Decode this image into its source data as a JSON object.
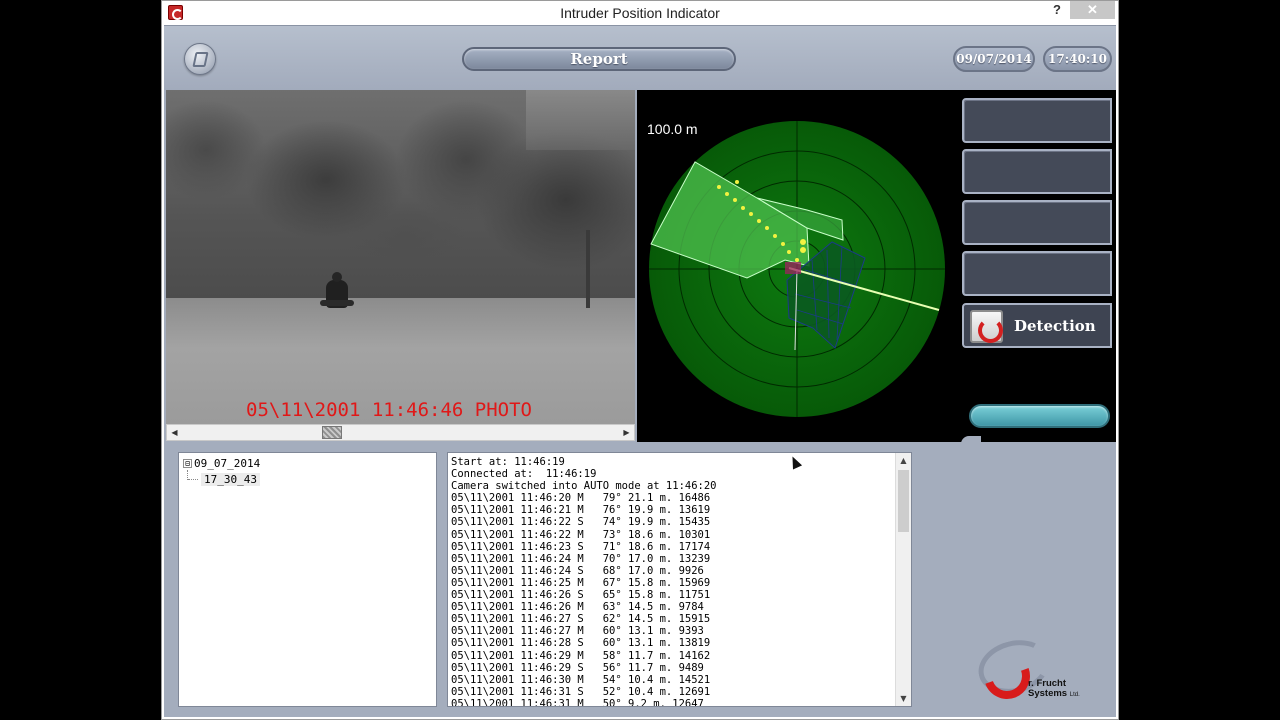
{
  "window": {
    "title": "Intruder Position Indicator",
    "help_label": "?",
    "close_label": "✕"
  },
  "header": {
    "report_label": "Report",
    "date": "09/07/2014",
    "time": "17:40:10"
  },
  "camera": {
    "overlay": "05\\11\\2001 11:46:46 PHOTO"
  },
  "radar": {
    "scale_label": "100.0 m"
  },
  "side_panel": {
    "detection_label": "Detection"
  },
  "tree": {
    "root_label": "09_07_2014",
    "child_label": "17_30_43",
    "expander": "⊟"
  },
  "log": {
    "lines": [
      "Start at: 11:46:19",
      "Connected at:  11:46:19",
      "Camera switched into AUTO mode at 11:46:20",
      "05\\11\\2001 11:46:20 M   79° 21.1 m. 16486",
      "05\\11\\2001 11:46:21 M   76° 19.9 m. 13619",
      "05\\11\\2001 11:46:22 S   74° 19.9 m. 15435",
      "05\\11\\2001 11:46:22 M   73° 18.6 m. 10301",
      "05\\11\\2001 11:46:23 S   71° 18.6 m. 17174",
      "05\\11\\2001 11:46:24 M   70° 17.0 m. 13239",
      "05\\11\\2001 11:46:24 S   68° 17.0 m. 9926",
      "05\\11\\2001 11:46:25 M   67° 15.8 m. 15969",
      "05\\11\\2001 11:46:26 S   65° 15.8 m. 11751",
      "05\\11\\2001 11:46:26 M   63° 14.5 m. 9784",
      "05\\11\\2001 11:46:27 S   62° 14.5 m. 15915",
      "05\\11\\2001 11:46:27 M   60° 13.1 m. 9393",
      "05\\11\\2001 11:46:28 S   60° 13.1 m. 13819",
      "05\\11\\2001 11:46:29 M   58° 11.7 m. 14162",
      "05\\11\\2001 11:46:29 S   56° 11.7 m. 9489",
      "05\\11\\2001 11:46:30 M   54° 10.4 m. 14521",
      "05\\11\\2001 11:46:31 S   52° 10.4 m. 12691",
      "05\\11\\2001 11:46:31 M   50° 9.2 m. 12647"
    ]
  },
  "brand": {
    "line1": "r. Frucht",
    "line2": "Systems",
    "ltd": "Ltd."
  },
  "colors": {
    "radar_green": "#0a6a0a",
    "radar_highlight": "#36b83a",
    "overlay_red": "#e01818",
    "accent_teal": "#5cb8c4"
  },
  "icons": {
    "logo": "book-icon",
    "detection": "detection-logo-icon"
  }
}
